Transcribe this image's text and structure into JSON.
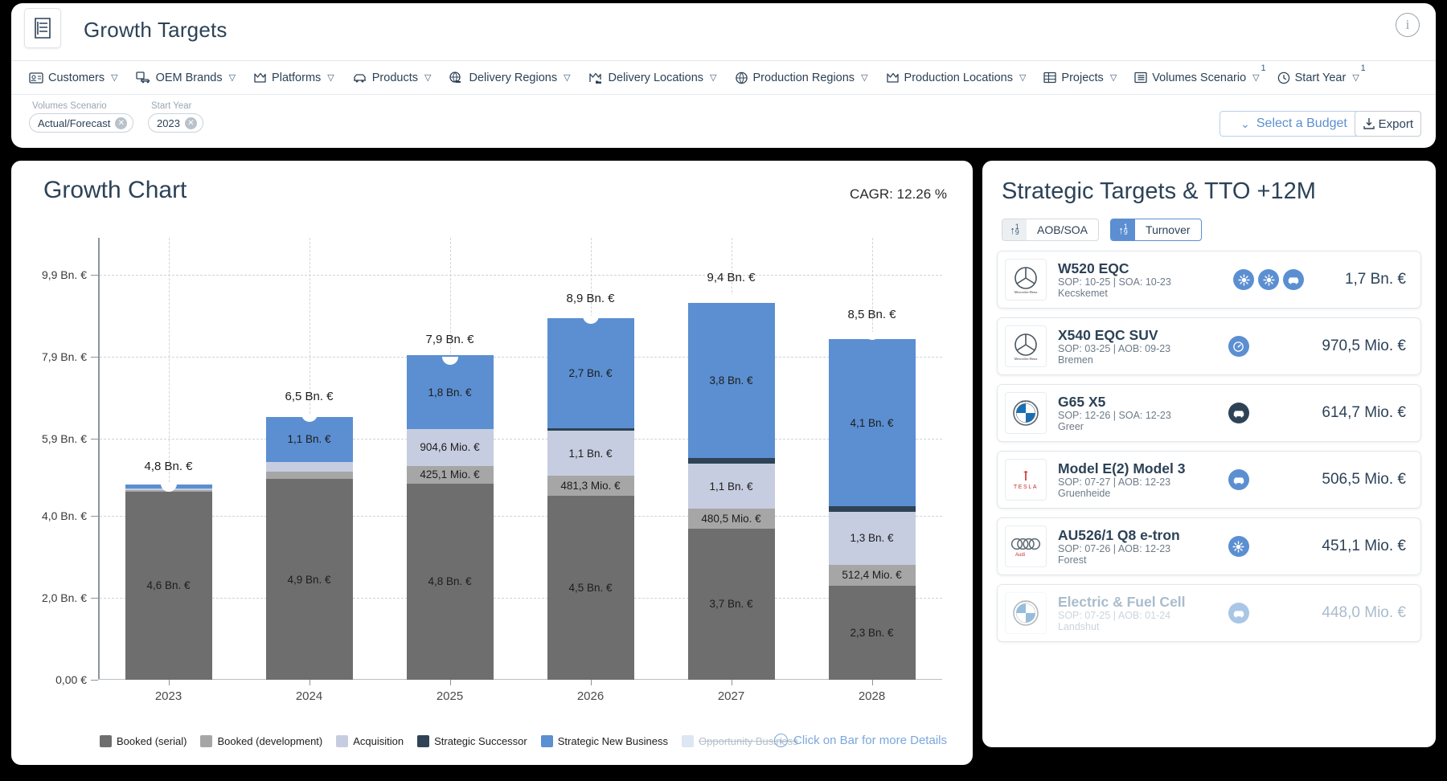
{
  "header": {
    "app_icon": "document-list-icon",
    "title": "Growth Targets",
    "info_icon": "info-icon",
    "filters": [
      {
        "label": "Customers",
        "icon": "contact-card-icon",
        "badge": ""
      },
      {
        "label": "OEM Brands",
        "icon": "brand-car-icon",
        "badge": ""
      },
      {
        "label": "Platforms",
        "icon": "platform-icon",
        "badge": ""
      },
      {
        "label": "Products",
        "icon": "car-icon",
        "badge": ""
      },
      {
        "label": "Delivery Regions",
        "icon": "globe-truck-icon",
        "badge": ""
      },
      {
        "label": "Delivery Locations",
        "icon": "location-truck-icon",
        "badge": ""
      },
      {
        "label": "Production Regions",
        "icon": "globe-icon",
        "badge": ""
      },
      {
        "label": "Production Locations",
        "icon": "factory-icon",
        "badge": ""
      },
      {
        "label": "Projects",
        "icon": "table-icon",
        "badge": ""
      },
      {
        "label": "Volumes Scenario",
        "icon": "list-icon",
        "badge": "1"
      },
      {
        "label": "Start Year",
        "icon": "clock-icon",
        "badge": "1"
      }
    ],
    "chips": [
      {
        "label": "Volumes Scenario",
        "value": "Actual/Forecast"
      },
      {
        "label": "Start Year",
        "value": "2023"
      }
    ],
    "budget_button": "Select a Budget",
    "export_button": "Export"
  },
  "chart_panel": {
    "title": "Growth Chart",
    "cagr": "CAGR: 12.26 %",
    "click_hint": "Click on Bar for more Details"
  },
  "chart_data": {
    "type": "bar",
    "title": "Growth Chart",
    "subtitle": "CAGR: 12.26 %",
    "xlabel": "",
    "ylabel": "",
    "stacked": true,
    "grid": true,
    "legend_position": "bottom",
    "ylim": [
      0,
      10.8
    ],
    "ytick_values": [
      0,
      2.0,
      4.0,
      5.9,
      7.9,
      9.9
    ],
    "ytick_labels": [
      "0,00 €",
      "2,0 Bn. €",
      "4,0 Bn. €",
      "5,9 Bn. €",
      "7,9 Bn. €",
      "9,9 Bn. €"
    ],
    "categories": [
      "2023",
      "2024",
      "2025",
      "2026",
      "2027",
      "2028"
    ],
    "series": [
      {
        "name": "Booked (serial)",
        "color": "#6e6e6e",
        "values": [
          4.6,
          4.9,
          4.8,
          4.5,
          3.7,
          2.3
        ],
        "labels": [
          "4,6 Bn. €",
          "4,9 Bn. €",
          "4,8 Bn. €",
          "4,5 Bn. €",
          "3,7 Bn. €",
          "2,3 Bn. €"
        ]
      },
      {
        "name": "Booked (development)",
        "color": "#a6a6a6",
        "values": [
          0.04,
          0.18,
          0.4251,
          0.4813,
          0.4805,
          0.5124
        ],
        "labels": [
          "",
          "",
          "425,1 Mio. €",
          "481,3 Mio. €",
          "480,5 Mio. €",
          "512,4 Mio. €"
        ]
      },
      {
        "name": "Acquisition",
        "color": "#c7cde0",
        "values": [
          0.03,
          0.25,
          0.9046,
          1.1,
          1.1,
          1.3
        ],
        "labels": [
          "",
          "",
          "904,6 Mio. €",
          "1,1 Bn. €",
          "1,1 Bn. €",
          "1,3 Bn. €"
        ]
      },
      {
        "name": "Strategic Successor",
        "color": "#2e4356",
        "values": [
          0.0,
          0.0,
          0.0,
          0.06,
          0.13,
          0.12
        ],
        "labels": [
          "",
          "",
          "",
          "",
          "",
          ""
        ]
      },
      {
        "name": "Strategic New Business",
        "color": "#5b8fd1",
        "values": [
          0.1,
          1.1,
          1.8,
          2.7,
          3.8,
          4.1
        ],
        "labels": [
          "",
          "1,1 Bn. €",
          "1,8 Bn. €",
          "2,7 Bn. €",
          "3,8 Bn. €",
          "4,1 Bn. €"
        ]
      },
      {
        "name": "Opportunity Business",
        "color": "#dde6f3",
        "values": [
          0,
          0,
          0,
          0,
          0,
          0
        ],
        "disabled": true,
        "labels": [
          "",
          "",
          "",
          "",
          "",
          ""
        ]
      }
    ],
    "totals": [
      4.8,
      6.5,
      7.9,
      8.9,
      9.4,
      8.5
    ],
    "total_labels": [
      "4,8 Bn. €",
      "6,5 Bn. €",
      "7,9 Bn. €",
      "8,9 Bn. €",
      "9,4 Bn. €",
      "8,5 Bn. €"
    ]
  },
  "right_panel": {
    "title": "Strategic Targets & TTO +12M",
    "toggles": [
      {
        "label": "AOB/SOA",
        "active": false,
        "icon": "sort-asc-icon"
      },
      {
        "label": "Turnover",
        "active": true,
        "icon": "sort-asc-icon"
      }
    ],
    "rows": [
      {
        "brand": "Mercedes-Benz",
        "logo": "mercedes-logo",
        "name": "W520 EQC",
        "sub": "SOP: 10-25 | SOA: 10-23",
        "location": "Kecskemet",
        "icons": [
          "electric-icon",
          "electric-icon",
          "car-icon"
        ],
        "icon_styles": [
          "blue",
          "blue",
          "blue"
        ],
        "value": "1,7 Bn. €",
        "faded": false
      },
      {
        "brand": "Mercedes-Benz",
        "logo": "mercedes-logo",
        "name": "X540 EQC SUV",
        "sub": "SOP: 03-25 | AOB: 09-23",
        "location": "Bremen",
        "icons": [
          "gauge-icon"
        ],
        "icon_styles": [
          "blue"
        ],
        "value": "970,5 Mio. €",
        "faded": false
      },
      {
        "brand": "BMW",
        "logo": "bmw-logo",
        "name": "G65 X5",
        "sub": "SOP: 12-26 | SOA: 12-23",
        "location": "Greer",
        "icons": [
          "car-icon"
        ],
        "icon_styles": [
          "dark"
        ],
        "value": "614,7 Mio. €",
        "faded": false
      },
      {
        "brand": "Tesla",
        "logo": "tesla-logo",
        "name": "Model E(2) Model 3",
        "sub": "SOP: 07-27 | AOB: 12-23",
        "location": "Gruenheide",
        "icons": [
          "car-icon"
        ],
        "icon_styles": [
          "blue"
        ],
        "value": "506,5 Mio. €",
        "faded": false
      },
      {
        "brand": "Audi",
        "logo": "audi-logo",
        "name": "AU526/1 Q8 e-tron",
        "sub": "SOP: 07-26 | AOB: 12-23",
        "location": "Forest",
        "icons": [
          "electric-icon"
        ],
        "icon_styles": [
          "blue"
        ],
        "value": "451,1 Mio. €",
        "faded": false
      },
      {
        "brand": "BMW",
        "logo": "bmw-logo",
        "name": "Electric & Fuel Cell",
        "sub": "SOP: 07-25 | AOB: 01-24",
        "location": "Landshut",
        "icons": [
          "car-icon"
        ],
        "icon_styles": [
          "blue"
        ],
        "value": "448,0 Mio. €",
        "faded": true
      }
    ]
  }
}
